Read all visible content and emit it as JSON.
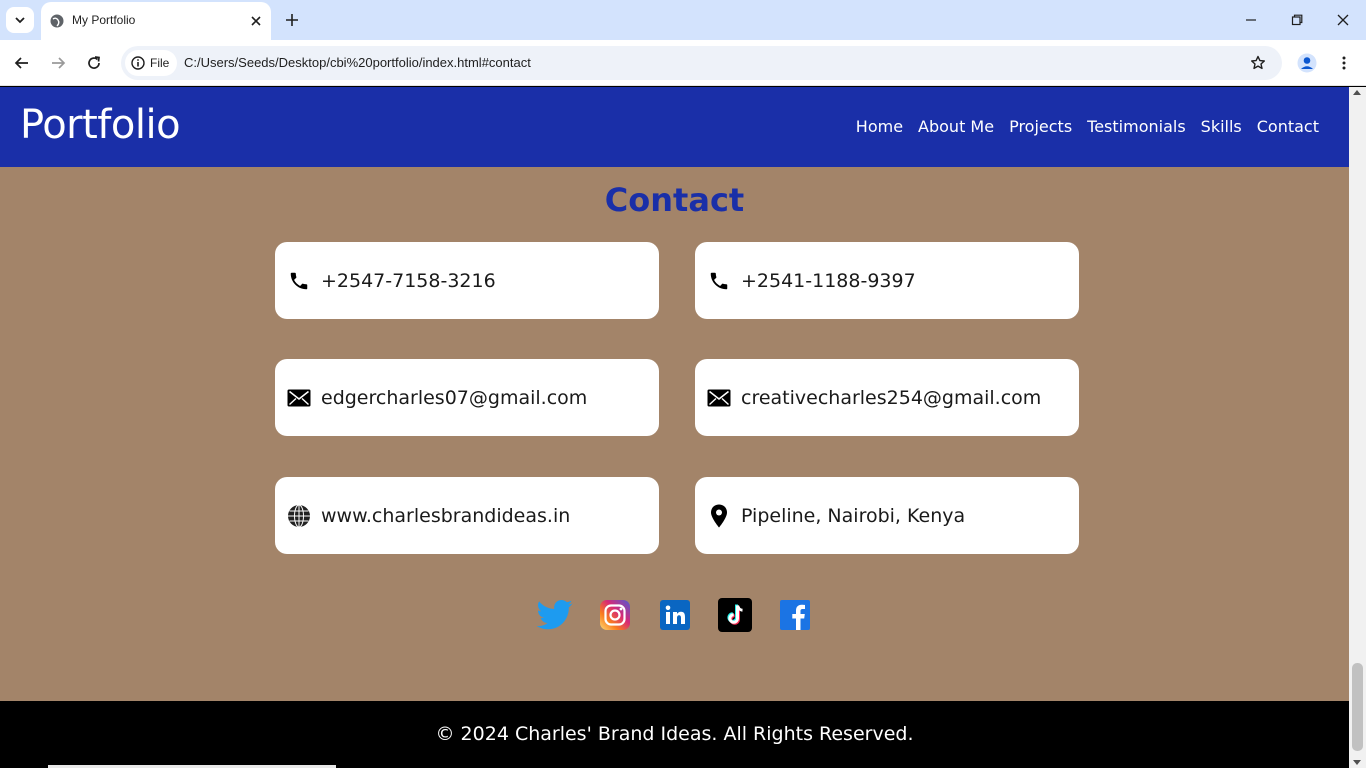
{
  "browser": {
    "tab_title": "My Portfolio",
    "url": "C:/Users/Seeds/Desktop/cbi%20portfolio/index.html#contact",
    "site_chip_label": "File"
  },
  "header": {
    "brand": "Portfolio",
    "nav": [
      "Home",
      "About Me",
      "Projects",
      "Testimonials",
      "Skills",
      "Contact"
    ]
  },
  "contact": {
    "title": "Contact",
    "cards": [
      {
        "icon": "phone-icon",
        "text": "+2547-7158-3216"
      },
      {
        "icon": "phone-icon",
        "text": "+2541-1188-9397"
      },
      {
        "icon": "mail-icon",
        "text": "edgercharles07@gmail.com"
      },
      {
        "icon": "mail-icon",
        "text": "creativecharles254@gmail.com"
      },
      {
        "icon": "globe-icon",
        "text": "www.charlesbrandideas.in"
      },
      {
        "icon": "location-pin-icon",
        "text": "Pipeline, Nairobi, Kenya"
      }
    ],
    "socials": [
      "twitter-icon",
      "instagram-icon",
      "linkedin-icon",
      "tiktok-icon",
      "facebook-icon"
    ]
  },
  "footer": {
    "copyright": "© 2024 Charles' Brand Ideas. All Rights Reserved."
  },
  "colors": {
    "header_bg": "#1a2fa8",
    "page_bg": "#a38469",
    "title": "#1a2fa8",
    "footer_bg": "#000000"
  }
}
